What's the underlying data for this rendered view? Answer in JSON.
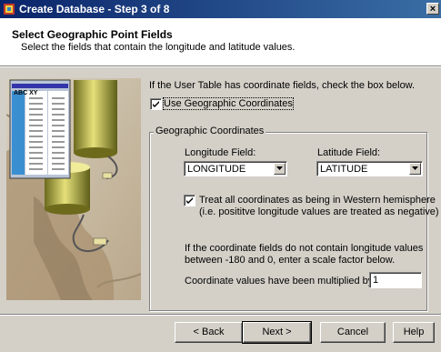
{
  "window": {
    "title": "Create Database - Step 3 of 8",
    "close_glyph": "×"
  },
  "header": {
    "title": "Select Geographic Point Fields",
    "subtitle": "Select the fields that contain the longitude and latitude values."
  },
  "intro_text": "If the User Table has coordinate fields, check the box below.",
  "use_geo": {
    "label": "Use Geographic Coordinates",
    "checked": true
  },
  "group": {
    "title": "Geographic Coordinates",
    "longitude": {
      "label": "Longitude Field:",
      "value": "LONGITUDE"
    },
    "latitude": {
      "label": "Latitude Field:",
      "value": "LATITUDE"
    },
    "western": {
      "checked": true,
      "line1": "Treat all coordinates as being in Western hemisphere",
      "line2": "(i.e. posititve longitude values are treated as negative)"
    },
    "scale_note_line1": "If the coordinate fields do not contain longitude values",
    "scale_note_line2": "between -180 and 0, enter a scale factor below.",
    "multiplier": {
      "label": "Coordinate values have been multiplied by:",
      "value": "1"
    }
  },
  "illustration": {
    "table_header": "ABC XY"
  },
  "buttons": {
    "back": "< Back",
    "next": "Next >",
    "cancel": "Cancel",
    "help": "Help"
  },
  "colors": {
    "titlebar_start": "#0a246a",
    "titlebar_end": "#3a6ea5",
    "face": "#d4d0c8"
  }
}
